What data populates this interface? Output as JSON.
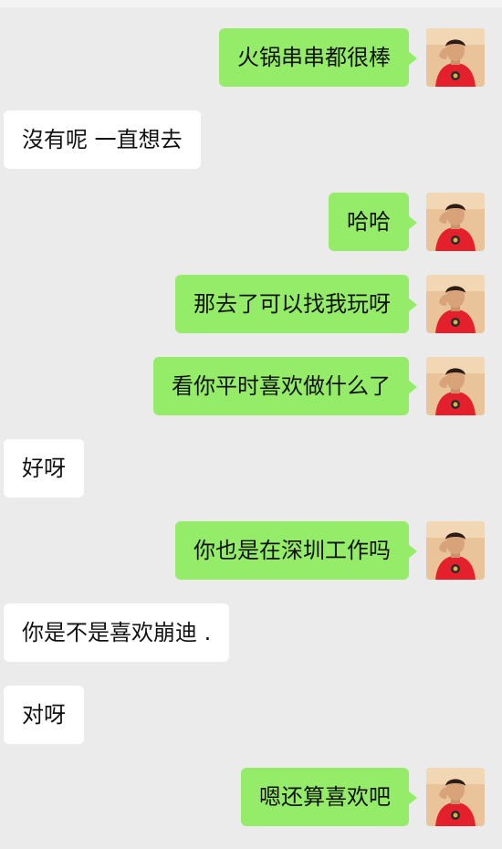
{
  "messages": [
    {
      "side": "out",
      "text": "火锅串串都很棒",
      "avatar": "user-avatar"
    },
    {
      "side": "in",
      "text": "沒有呢 一直想去"
    },
    {
      "side": "out",
      "text": "哈哈",
      "avatar": "user-avatar"
    },
    {
      "side": "out",
      "text": "那去了可以找我玩呀",
      "avatar": "user-avatar"
    },
    {
      "side": "out",
      "text": "看你平时喜欢做什么了",
      "avatar": "user-avatar"
    },
    {
      "side": "in",
      "text": "好呀"
    },
    {
      "side": "out",
      "text": "你也是在深圳工作吗",
      "avatar": "user-avatar"
    },
    {
      "side": "in",
      "text": "你是不是喜欢崩迪 ."
    },
    {
      "side": "in",
      "text": "对呀"
    },
    {
      "side": "out",
      "text": "嗯还算喜欢吧",
      "avatar": "user-avatar"
    }
  ],
  "colors": {
    "background": "#ebebeb",
    "outgoing_bubble": "#95ec69",
    "incoming_bubble": "#ffffff",
    "avatar_shirt": "#e3202c"
  }
}
